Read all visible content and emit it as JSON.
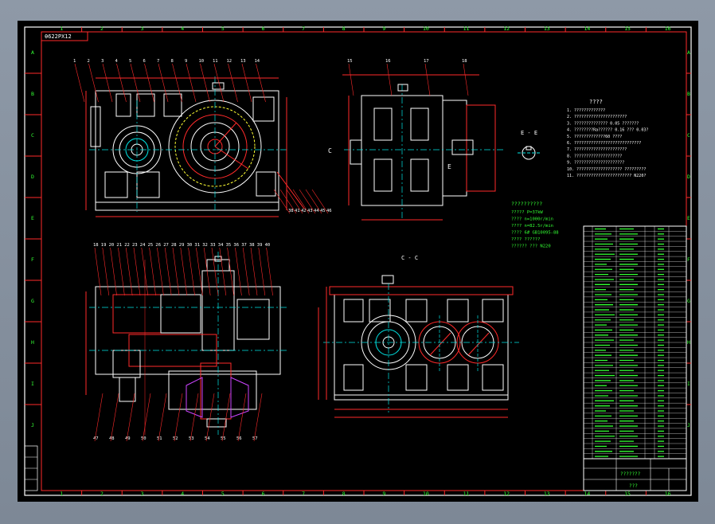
{
  "title_box": "θ622PX12",
  "col_labels": [
    "1",
    "2",
    "3",
    "4",
    "5",
    "6",
    "7",
    "8",
    "9",
    "10",
    "11",
    "12",
    "13",
    "14",
    "15",
    "16"
  ],
  "row_labels": [
    "A",
    "B",
    "C",
    "D",
    "E",
    "F",
    "G",
    "H",
    "I",
    "J"
  ],
  "section_ee": "E - E",
  "section_cc": "C - C",
  "view_letters": [
    "C",
    "E"
  ],
  "tech_req": {
    "title": "????",
    "lines": [
      "1. ?????????????",
      "2. ??????????????????????",
      "3. ?????????????? 0.05 ???????",
      "4. ????????Ra?????? 0.16 ??? 0.03?",
      "5. ?????????????60 ????",
      "6. ????????????????????????????",
      "7. ??????????????????????",
      "8. ????????????????????",
      "9. ?????????????????????",
      "10. ??????????????????? ?????????",
      "11. ??????????????????????? N220?"
    ]
  },
  "specs": {
    "title": "??????????",
    "lines": [
      "????? P=37kW",
      "???? n=1000r/min",
      "???? n=82.5r/min",
      "???? 6# GB10095-88",
      "???? ??????",
      "?????? ??? N220"
    ]
  },
  "title_block": {
    "name": "???????",
    "sub": "???"
  },
  "callouts_top": [
    "1",
    "2",
    "3",
    "4",
    "5",
    "6",
    "7",
    "8",
    "9",
    "10",
    "11",
    "12",
    "13",
    "14"
  ],
  "callouts_top2": [
    "15",
    "16",
    "17",
    "18"
  ],
  "callouts_mid": [
    "18",
    "19",
    "20",
    "21",
    "22",
    "23",
    "24",
    "25",
    "26",
    "27",
    "28",
    "29",
    "30",
    "31",
    "32",
    "33",
    "34",
    "35",
    "36",
    "37",
    "38",
    "39",
    "40"
  ],
  "callouts_bot": [
    "47",
    "48",
    "49",
    "50",
    "51",
    "52",
    "53",
    "54",
    "55",
    "56",
    "57"
  ],
  "callouts_side": [
    "38",
    "41",
    "42",
    "43",
    "44",
    "45",
    "46"
  ],
  "colors": {
    "frame": "#ffffff",
    "outline": "#ffffff",
    "dims": "#ff2a2a",
    "center": "#00e6e6",
    "text": "#33ff33",
    "accent": "#ffff33",
    "purple": "#cc44ff"
  }
}
